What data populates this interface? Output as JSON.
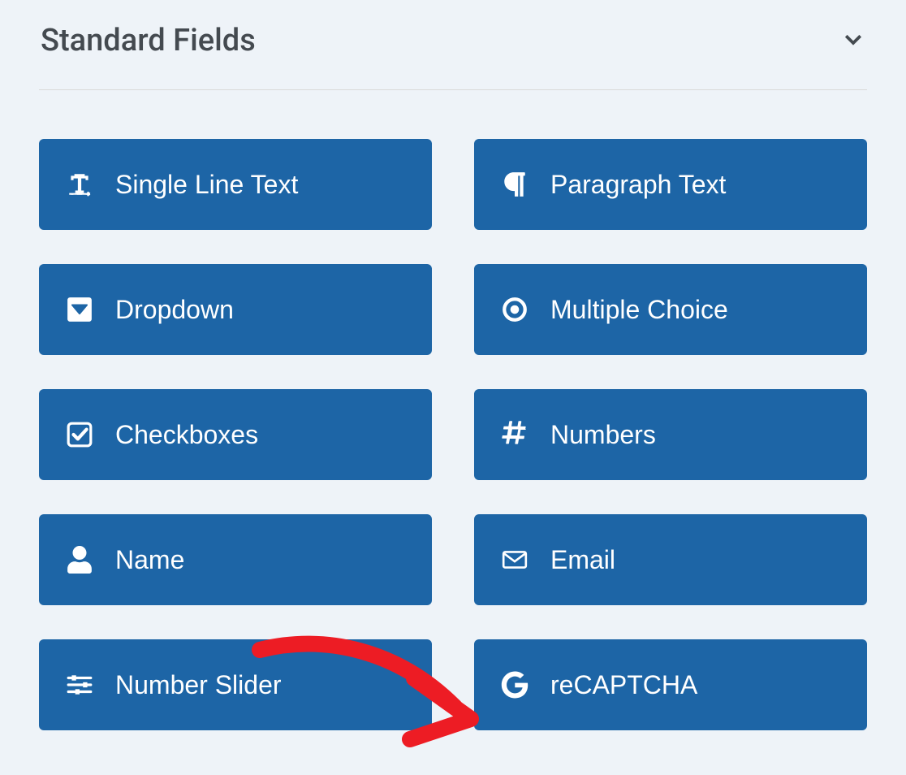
{
  "header": {
    "title": "Standard Fields"
  },
  "fields": {
    "singleLineText": {
      "label": "Single Line Text",
      "icon": "text-cursor-icon"
    },
    "paragraphText": {
      "label": "Paragraph Text",
      "icon": "paragraph-icon"
    },
    "dropdown": {
      "label": "Dropdown",
      "icon": "caret-square-down-icon"
    },
    "multipleChoice": {
      "label": "Multiple Choice",
      "icon": "radio-icon"
    },
    "checkboxes": {
      "label": "Checkboxes",
      "icon": "checkbox-icon"
    },
    "numbers": {
      "label": "Numbers",
      "icon": "hash-icon"
    },
    "name": {
      "label": "Name",
      "icon": "user-icon"
    },
    "email": {
      "label": "Email",
      "icon": "envelope-icon"
    },
    "numberSlider": {
      "label": "Number Slider",
      "icon": "sliders-icon"
    },
    "recaptcha": {
      "label": "reCAPTCHA",
      "icon": "google-g-icon"
    }
  },
  "annotation": {
    "arrow_color": "#ed1c24"
  }
}
